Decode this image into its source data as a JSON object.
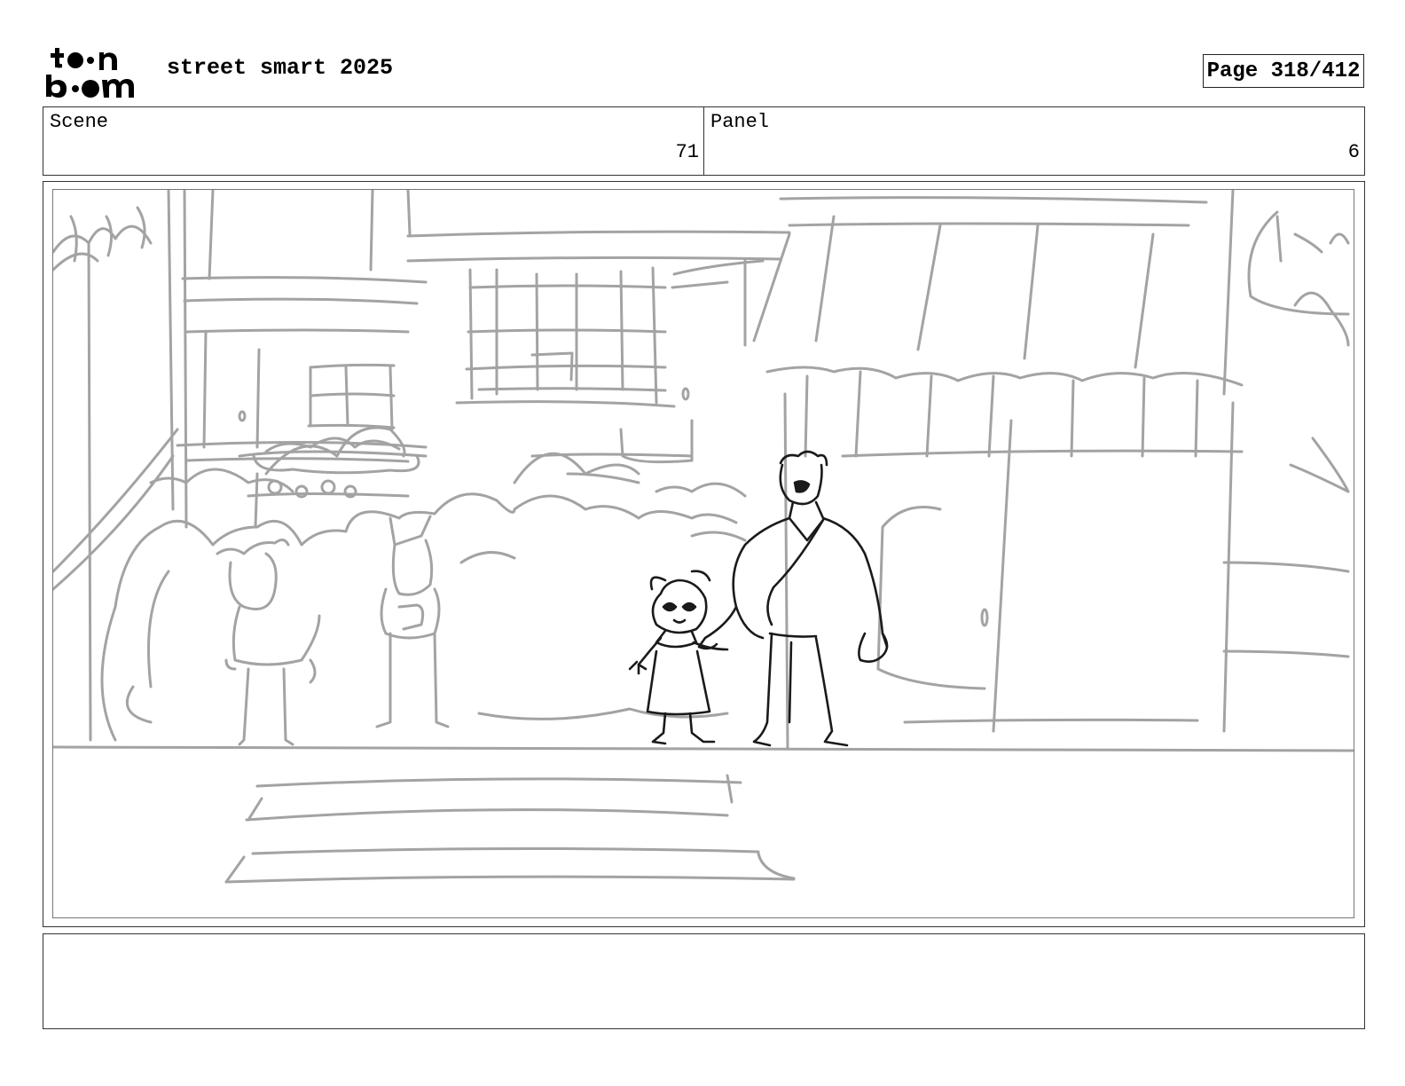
{
  "header": {
    "logo_text_top": "toon",
    "logo_text_bottom": "boom",
    "project_title": "street smart 2025",
    "page_indicator": "Page 318/412"
  },
  "info": {
    "scene_label": "Scene",
    "scene_value": "71",
    "panel_label": "Panel",
    "panel_value": "6"
  },
  "notes": {
    "text": ""
  },
  "colors": {
    "background": "#ffffff",
    "border": "#333333",
    "sketch_background": "#a0a0a0",
    "sketch_foreground": "#1a1a1a"
  }
}
